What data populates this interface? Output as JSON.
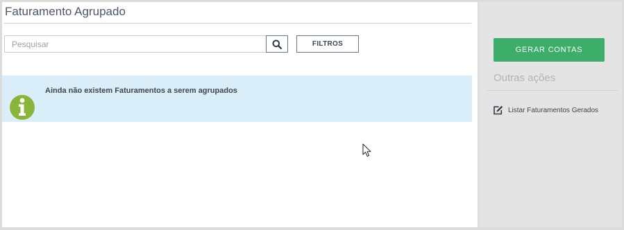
{
  "page": {
    "title": "Faturamento Agrupado"
  },
  "search": {
    "placeholder": "Pesquisar",
    "value": ""
  },
  "toolbar": {
    "search_icon": "search-icon",
    "filters_label": "FILTROS"
  },
  "alert": {
    "icon": "info-icon",
    "message": "Ainda não existem Faturamentos a serem agrupados",
    "background": "#d9eef8",
    "icon_color": "#8bb43a"
  },
  "sidebar": {
    "generate_label": "GERAR CONTAS",
    "generate_color": "#3dae6a",
    "other_actions_title": "Outras ações",
    "actions": [
      {
        "label": "Listar Faturamentos Gerados",
        "icon": "edit-icon"
      }
    ]
  }
}
